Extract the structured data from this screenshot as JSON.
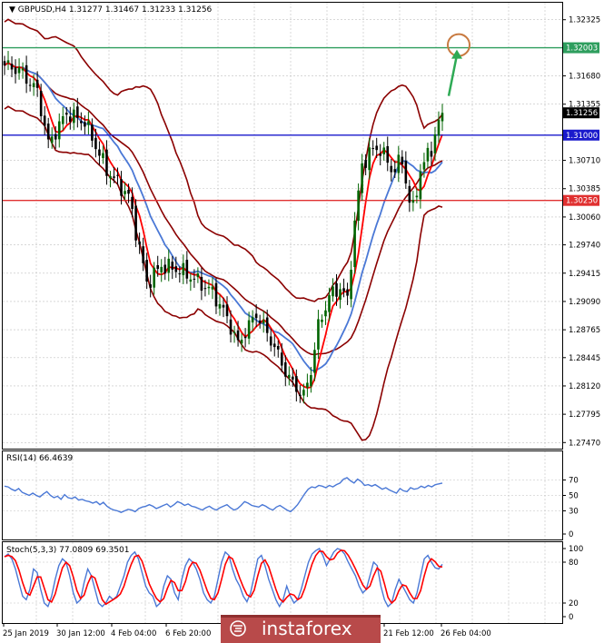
{
  "symbol_line": "GBPUSD,H4  1.31277 1.31467 1.31233 1.31256",
  "colors": {
    "bg": "#ffffff",
    "grid": "#c0c0c0",
    "bull": "#006400",
    "bear": "#000000",
    "bb": "#8b0000",
    "ma_fast": "#ff0000",
    "ma_slow": "#4a78d6",
    "line_top": "#2e9e5e",
    "line_mid": "#1a1acc",
    "line_low": "#e03030",
    "arrow": "#2eaa55",
    "circle": "#c87a40",
    "rsi": "#4a78d6",
    "stoch_main": "#4a78d6",
    "stoch_signal": "#ff0000",
    "logo_bg": "#b84a4a"
  },
  "price_axis": {
    "min": 1.274,
    "max": 1.3252,
    "ticks": [
      "1.32325",
      "1.31680",
      "1.31355",
      "1.30710",
      "1.30385",
      "1.30060",
      "1.29740",
      "1.29415",
      "1.29090",
      "1.28765",
      "1.28445",
      "1.28120",
      "1.27795",
      "1.27470"
    ]
  },
  "levels": [
    {
      "label": "1.32003",
      "value": 1.32003,
      "role": "top"
    },
    {
      "label": "1.31256",
      "value": 1.31256,
      "role": "current"
    },
    {
      "label": "1.31000",
      "value": 1.31,
      "role": "mid"
    },
    {
      "label": "1.30250",
      "value": 1.3025,
      "role": "low"
    }
  ],
  "rsi": {
    "title": "RSI(14) 66.4639",
    "ticks": [
      "70",
      "50",
      "30",
      "0"
    ],
    "levels": [
      70,
      50,
      30
    ],
    "values": [
      62,
      61,
      58,
      56,
      59,
      54,
      52,
      50,
      53,
      50,
      48,
      52,
      55,
      50,
      47,
      49,
      45,
      51,
      47,
      46,
      48,
      44,
      45,
      43,
      42,
      40,
      42,
      38,
      41,
      36,
      33,
      31,
      30,
      28,
      30,
      32,
      31,
      29,
      33,
      35,
      36,
      38,
      36,
      33,
      35,
      37,
      39,
      35,
      38,
      42,
      40,
      37,
      39,
      36,
      35,
      33,
      31,
      34,
      36,
      33,
      31,
      34,
      36,
      38,
      34,
      31,
      33,
      37,
      42,
      40,
      37,
      36,
      35,
      38,
      36,
      33,
      31,
      35,
      37,
      34,
      31,
      29,
      33,
      38,
      45,
      52,
      58,
      61,
      60,
      63,
      62,
      60,
      63,
      61,
      64,
      66,
      71,
      73,
      69,
      66,
      71,
      68,
      63,
      64,
      62,
      64,
      61,
      58,
      60,
      57,
      55,
      53,
      59,
      56,
      55,
      60,
      58,
      59,
      62,
      60,
      63,
      61,
      64,
      65,
      66
    ]
  },
  "stoch": {
    "title": "Stoch(5,3,3) 77.0809 69.3501",
    "ticks": [
      "100",
      "80",
      "20",
      "0"
    ],
    "levels": [
      80,
      20
    ],
    "main": [
      88,
      92,
      85,
      70,
      50,
      30,
      25,
      40,
      70,
      65,
      40,
      20,
      15,
      30,
      55,
      75,
      85,
      80,
      60,
      35,
      20,
      25,
      50,
      70,
      60,
      40,
      20,
      15,
      20,
      30,
      25,
      30,
      45,
      60,
      80,
      90,
      95,
      85,
      65,
      45,
      35,
      30,
      15,
      20,
      45,
      60,
      55,
      35,
      25,
      55,
      75,
      85,
      80,
      70,
      55,
      35,
      25,
      20,
      30,
      55,
      80,
      95,
      90,
      70,
      55,
      45,
      30,
      22,
      35,
      60,
      85,
      90,
      75,
      55,
      40,
      25,
      15,
      25,
      45,
      30,
      20,
      25,
      40,
      60,
      80,
      92,
      97,
      100,
      90,
      75,
      85,
      95,
      100,
      98,
      92,
      80,
      70,
      60,
      45,
      35,
      40,
      60,
      80,
      75,
      45,
      25,
      15,
      20,
      40,
      55,
      45,
      35,
      25,
      20,
      35,
      60,
      85,
      90,
      80,
      72,
      70,
      77
    ]
  },
  "x_axis": {
    "labels": [
      "25 Jan 2019",
      "30 Jan 12:00",
      "4 Feb 04:00",
      "6 Feb 20:00",
      "21 Feb 12:00",
      "26 Feb 04:00"
    ]
  },
  "logo": {
    "text": "instaforex"
  }
}
